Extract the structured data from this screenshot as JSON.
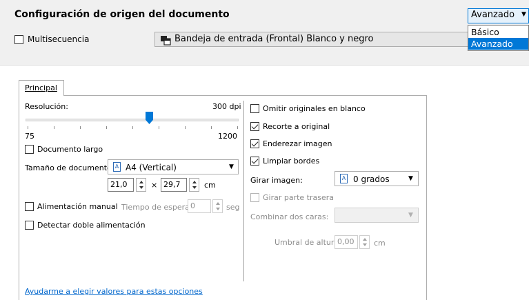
{
  "header": {
    "title": "Configuración de origen del documento",
    "multisequence": {
      "label": "Multisecuencia",
      "checked": false
    },
    "tray": {
      "label": "Bandeja de entrada (Frontal) Blanco y negro",
      "icon": "scanner-tray-icon"
    },
    "mode": {
      "selected": "Avanzado",
      "options": [
        "Básico",
        "Avanzado"
      ],
      "highlighted": "Avanzado"
    }
  },
  "tabs": [
    {
      "label": "Principal",
      "active": true
    }
  ],
  "left": {
    "resolution": {
      "label": "Resolución:",
      "value_text": "300 dpi",
      "min_label": "75",
      "max_label": "1200",
      "value": 300,
      "min": 75,
      "max": 1200
    },
    "long_document": {
      "label": "Documento largo",
      "checked": false
    },
    "document_size": {
      "label": "Tamaño de documento:",
      "value": "A4 (Vertical)",
      "icon": "page-portrait-icon",
      "width": "21,0",
      "times": "×",
      "height": "29,7",
      "unit": "cm"
    },
    "manual_feed": {
      "label": "Alimentación manual",
      "checked": false
    },
    "timeout": {
      "label": "Tiempo de espera:",
      "value": "0",
      "unit": "seg",
      "enabled": false
    },
    "double_feed": {
      "label": "Detectar doble alimentación",
      "checked": false
    }
  },
  "right": {
    "skip_blank": {
      "label": "Omitir originales en blanco",
      "checked": false
    },
    "crop": {
      "label": "Recorte a original",
      "checked": true
    },
    "deskew": {
      "label": "Enderezar imagen",
      "checked": true
    },
    "edge_clean": {
      "label": "Limpiar bordes",
      "checked": true
    },
    "rotate": {
      "label": "Girar imagen:",
      "value": "0 grados",
      "icon": "page-portrait-icon"
    },
    "rotate_back": {
      "label": "Girar parte trasera",
      "checked": false,
      "enabled": false
    },
    "merge": {
      "label": "Combinar dos caras:",
      "value": "",
      "enabled": false
    },
    "height_threshold": {
      "label": "Umbral de altura:",
      "value": "0,00",
      "unit": "cm",
      "enabled": false
    }
  },
  "help_link": "Ayudarme a elegir valores para estas opciones",
  "colors": {
    "accent": "#0078d7",
    "link": "#0066cc",
    "band": "#f0f0f0"
  }
}
